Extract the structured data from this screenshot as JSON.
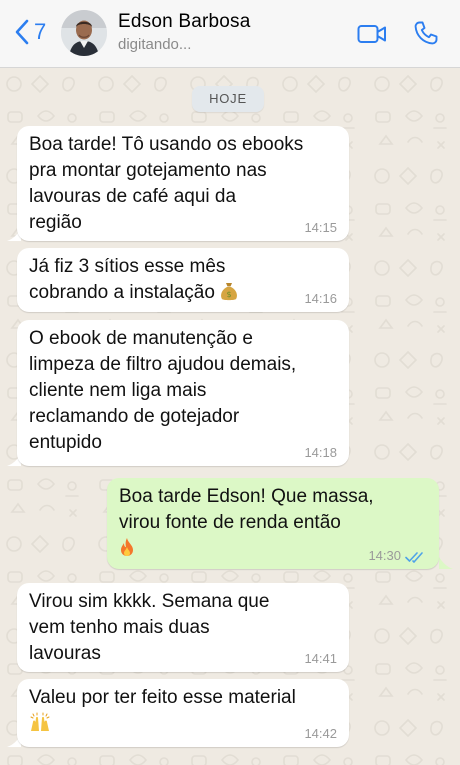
{
  "header": {
    "back_count": "7",
    "contact_name": "Edson Barbosa",
    "contact_status": "digitando..."
  },
  "chat": {
    "date_label": "HOJE",
    "messages": [
      {
        "direction": "in",
        "text": "Boa tarde! Tô usando os ebooks\npra montar gotejamento nas\nlavouras de café aqui da\nregião",
        "time": "14:15"
      },
      {
        "direction": "in",
        "text": "Já fiz 3 sítios esse mês\ncobrando a instalação",
        "emoji": "money-bag-icon",
        "time": "14:16"
      },
      {
        "direction": "in",
        "text": "O ebook de manutenção e\nlimpeza de filtro ajudou demais,\ncliente nem liga mais\nreclamando de gotejador\nentupido",
        "time": "14:18"
      },
      {
        "direction": "out",
        "text": "Boa tarde Edson! Que massa,\nvirou fonte de renda então",
        "emoji": "fire-icon",
        "time": "14:30",
        "status": "read"
      },
      {
        "direction": "in",
        "text": "Virou sim kkkk. Semana que\nvem tenho mais duas\nlavouras",
        "time": "14:41"
      },
      {
        "direction": "in",
        "text": "Valeu por ter feito esse material",
        "emoji": "raised-hands-icon",
        "time": "14:42"
      }
    ]
  },
  "colors": {
    "accent": "#2c7ef0",
    "incoming_bubble": "#ffffff",
    "outgoing_bubble": "#dcf8c6",
    "wallpaper": "#efeae2",
    "read_ticks": "#4fa3e8"
  }
}
